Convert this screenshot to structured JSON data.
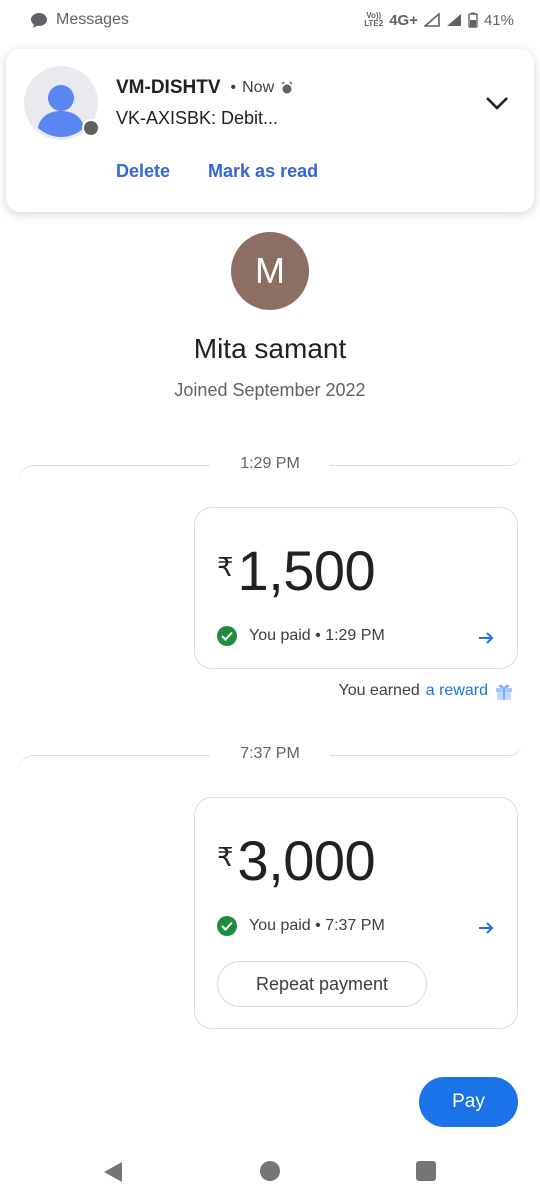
{
  "status_bar": {
    "app_label": "Messages",
    "volte": "Vo)) LTE2",
    "network": "4G+",
    "battery": "41%"
  },
  "notification": {
    "sender": "VM-DISHTV",
    "dot": "•",
    "time": "Now",
    "body": "VK-AXISBK: Debit...",
    "actions": {
      "delete": "Delete",
      "mark_read": "Mark as read"
    }
  },
  "profile": {
    "initial": "M",
    "name": "Mita samant",
    "joined": "Joined September 2022"
  },
  "transactions": [
    {
      "time": "1:29 PM",
      "currency": "₹",
      "amount": "1,500",
      "status": "You paid • 1:29 PM"
    },
    {
      "time": "7:37 PM",
      "currency": "₹",
      "amount": "3,000",
      "status": "You paid • 7:37 PM",
      "repeat_label": "Repeat payment"
    }
  ],
  "reward": {
    "prefix": "You earned",
    "link": "a reward"
  },
  "pay_button": "Pay",
  "colors": {
    "accent": "#1a73e8",
    "success": "#1e8e3e",
    "avatar": "#8d6e63"
  }
}
